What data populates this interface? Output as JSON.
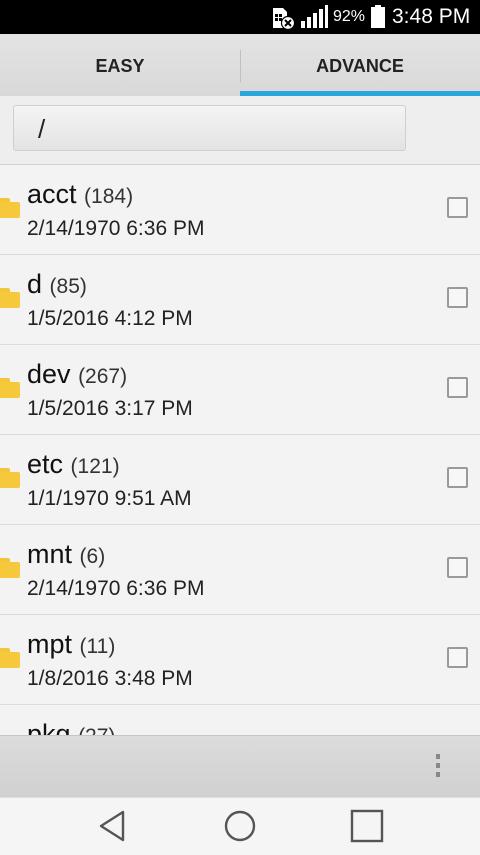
{
  "status_bar": {
    "battery_percent": "92%",
    "time": "3:48 PM"
  },
  "tabs": [
    {
      "label": "EASY",
      "selected": false
    },
    {
      "label": "ADVANCE",
      "selected": true
    }
  ],
  "path": {
    "value": "/"
  },
  "files": [
    {
      "name": "acct",
      "count": "(184)",
      "date": "2/14/1970 6:36 PM"
    },
    {
      "name": "d",
      "count": "(85)",
      "date": "1/5/2016 4:12 PM"
    },
    {
      "name": "dev",
      "count": "(267)",
      "date": "1/5/2016 3:17 PM"
    },
    {
      "name": "etc",
      "count": "(121)",
      "date": "1/1/1970 9:51 AM"
    },
    {
      "name": "mnt",
      "count": "(6)",
      "date": "2/14/1970 6:36 PM"
    },
    {
      "name": "mpt",
      "count": "(11)",
      "date": "1/8/2016 3:48 PM"
    },
    {
      "name": "pkg",
      "count": "(27)",
      "date": ""
    }
  ],
  "colors": {
    "accent": "#2aa6dd",
    "folder": "#f6c83b"
  },
  "icons": {
    "sim": "sim-no-service-icon",
    "signal": "signal-bars-icon",
    "battery": "battery-icon",
    "folder": "folder-icon",
    "overflow": "overflow-menu-icon",
    "back": "back-triangle-icon",
    "home": "home-circle-icon",
    "recents": "recents-square-icon"
  }
}
